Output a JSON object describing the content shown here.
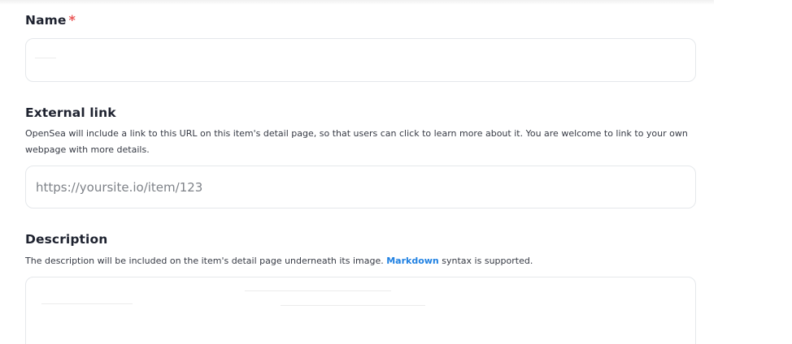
{
  "name_field": {
    "label": "Name",
    "required_mark": "*",
    "value": "",
    "placeholder": ""
  },
  "external_link_field": {
    "label": "External link",
    "help_text": "OpenSea will include a link to this URL on this item's detail page, so that users can click to learn more about it. You are welcome to link to your own webpage with more details.",
    "value": "",
    "placeholder": "https://yoursite.io/item/123"
  },
  "description_field": {
    "label": "Description",
    "help_text_before": "The description will be included on the item's detail page underneath its image.",
    "link_text": "Markdown",
    "help_text_after": "syntax is supported.",
    "value": ""
  },
  "colors": {
    "link": "#2081e2",
    "required": "#eb5757",
    "border": "#e5e8eb"
  }
}
